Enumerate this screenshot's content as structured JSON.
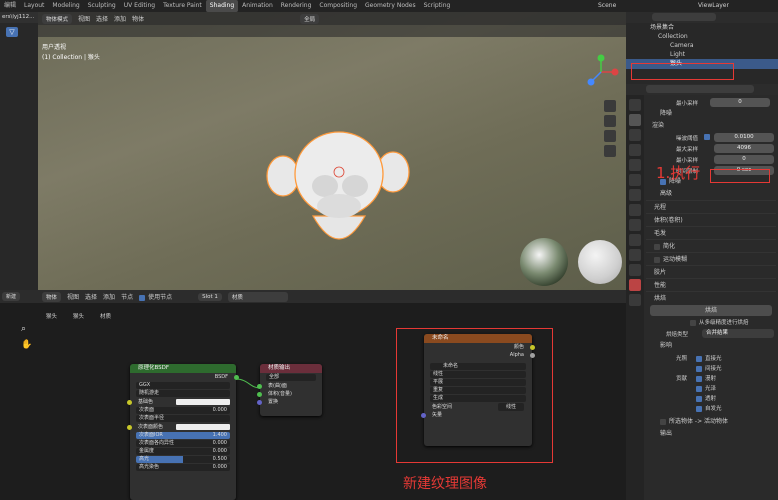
{
  "topbar": {
    "items": [
      "编辑",
      "Layout",
      "Modeling",
      "Sculpting",
      "UV Editing",
      "Texture Paint",
      "Shading",
      "Animation",
      "Rendering",
      "Compositing",
      "Geometry Nodes",
      "Scripting"
    ],
    "active": "Shading",
    "scene": "Scene",
    "view_layer": "ViewLayer"
  },
  "file_browser": {
    "label": "ers\\lyj112..."
  },
  "viewport": {
    "mode": "物体模式",
    "menus": [
      "视图",
      "选择",
      "添加",
      "物体"
    ],
    "global": "全局",
    "title": "用户透视",
    "subtitle": "(1) Collection | 猴头"
  },
  "outliner": {
    "title": "场景集合",
    "items": [
      "Collection",
      "Camera",
      "Light",
      "猴头"
    ]
  },
  "props": {
    "min_samples": {
      "label": "最小采样",
      "value": "0"
    },
    "denoise1": "降噪",
    "render": "渲染",
    "noise_threshold": {
      "label": "噪波阈值",
      "value": "0.0100"
    },
    "max_samples": {
      "label": "最大采样",
      "value": "4096"
    },
    "min_samples2": {
      "label": "最小采样",
      "value": "0"
    },
    "time_limit": {
      "label": "时间限制",
      "value": "0 sec"
    },
    "denoise2": "降噪",
    "advanced": "高级",
    "sections": [
      "光程",
      "体积(卷积)",
      "毛发",
      "简化",
      "运动模糊",
      "胶片",
      "性能"
    ],
    "bake": "烘焙",
    "bake_button": "烘焙",
    "bake_from_multires": "从多级精度进行烘焙",
    "bake_type": {
      "label": "烘焙类型",
      "value": "合并结果"
    },
    "influence": "影响",
    "lighting": {
      "label": "光照",
      "opts": [
        "直接光",
        "间接光"
      ]
    },
    "contributions": {
      "label": "贡献",
      "opts": [
        "漫射",
        "光泽",
        "透射",
        "自发光"
      ]
    },
    "selected_to_active": "所选物体 -> 活动物体",
    "output": "输出"
  },
  "node_editor": {
    "new_label": "新建",
    "object": "物体",
    "menus": [
      "视图",
      "选择",
      "添加",
      "节点"
    ],
    "use_nodes": "使用节点",
    "slot": "Slot 1",
    "material": "材质",
    "breadcrumb": [
      "猴头",
      "猴头",
      "材质"
    ]
  },
  "bsdf": {
    "title": "原理化BSDF",
    "out": "BSDF",
    "dist": "GGX",
    "sss": "随机游走",
    "rows": [
      {
        "l": "基础色",
        "v": ""
      },
      {
        "l": "次表面",
        "v": "0.000"
      },
      {
        "l": "次表面半径",
        "v": ""
      },
      {
        "l": "次表面颜色",
        "v": ""
      },
      {
        "l": "次表面IOR",
        "v": "1.400"
      },
      {
        "l": "次表面各向异性",
        "v": "0.000"
      },
      {
        "l": "金属度",
        "v": "0.000"
      },
      {
        "l": "高光",
        "v": "0.500"
      },
      {
        "l": "高光染色",
        "v": "0.000"
      }
    ]
  },
  "matout": {
    "title": "材质输出",
    "target": "全部",
    "rows": [
      "表(曲)面",
      "体积(音量)",
      "置换"
    ]
  },
  "imgtex": {
    "title": "未命名",
    "outs": [
      "颜色",
      "Alpha"
    ],
    "img": "未命名",
    "opts": [
      "线性",
      "平展",
      "重复",
      "生成"
    ],
    "colorspace": {
      "label": "色彩空间",
      "value": "线性"
    },
    "vector": "矢量"
  },
  "annotations": {
    "a1": "1.执行",
    "a2": "新建纹理图像"
  },
  "colors": {
    "accent": "#4772b3",
    "annot": "#e53935",
    "highlight": "#ff9a3c"
  }
}
